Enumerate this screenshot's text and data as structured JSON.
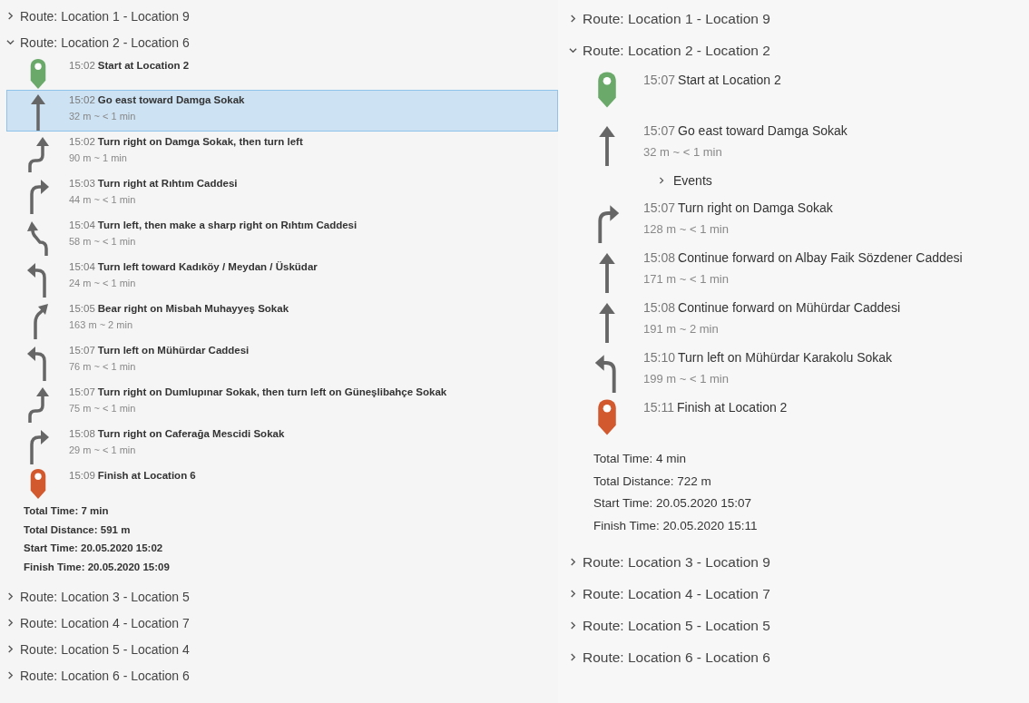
{
  "panels": [
    {
      "routes": [
        {
          "title": "Route: Location 1 - Location 9",
          "expanded": false
        },
        {
          "title": "Route: Location 2 - Location 6",
          "expanded": true,
          "steps": [
            {
              "kind": "start",
              "time": "15:02",
              "text": "Start at Location 2",
              "selected": false
            },
            {
              "kind": "straight",
              "time": "15:02",
              "text": "Go east toward Damga Sokak",
              "detail": "32 m ~ < 1 min",
              "selected": true
            },
            {
              "kind": "right_then_left",
              "time": "15:02",
              "text": "Turn right on Damga Sokak, then turn left",
              "detail": "90 m ~ 1 min",
              "selected": false
            },
            {
              "kind": "right",
              "time": "15:03",
              "text": "Turn right at Rıhtım Caddesi",
              "detail": "44 m ~ < 1 min",
              "selected": false
            },
            {
              "kind": "left_then_sharp_right",
              "time": "15:04",
              "text": "Turn left, then make a sharp right on Rıhtım Caddesi",
              "detail": "58 m ~ < 1 min",
              "selected": false
            },
            {
              "kind": "left",
              "time": "15:04",
              "text": "Turn left toward Kadıköy / Meydan / Üsküdar",
              "detail": "24 m ~ < 1 min",
              "selected": false
            },
            {
              "kind": "bear_right",
              "time": "15:05",
              "text": "Bear right on Misbah Muhayyeş Sokak",
              "detail": "163 m ~ 2 min",
              "selected": false
            },
            {
              "kind": "left",
              "time": "15:07",
              "text": "Turn left on Mühürdar Caddesi",
              "detail": "76 m ~ < 1 min",
              "selected": false
            },
            {
              "kind": "right_then_left",
              "time": "15:07",
              "text": "Turn right on Dumlupınar Sokak, then turn left on Güneşlibahçe Sokak",
              "detail": "75 m ~ < 1 min",
              "selected": false
            },
            {
              "kind": "right",
              "time": "15:08",
              "text": "Turn right on Caferağa Mescidi Sokak",
              "detail": "29 m ~ < 1 min",
              "selected": false
            },
            {
              "kind": "finish",
              "time": "15:09",
              "text": "Finish at Location 6",
              "selected": false
            }
          ],
          "summary": [
            "Total Time: 7 min",
            "Total Distance: 591 m",
            "Start Time: 20.05.2020 15:02",
            "Finish Time: 20.05.2020 15:09"
          ]
        },
        {
          "title": "Route: Location 3 - Location 5",
          "expanded": false
        },
        {
          "title": "Route: Location 4 - Location 7",
          "expanded": false
        },
        {
          "title": "Route: Location 5 - Location 4",
          "expanded": false
        },
        {
          "title": "Route: Location 6 - Location 6",
          "expanded": false
        }
      ]
    },
    {
      "routes": [
        {
          "title": "Route: Location 1 - Location 9",
          "expanded": false
        },
        {
          "title": "Route: Location 2 - Location 2",
          "expanded": true,
          "steps": [
            {
              "kind": "start",
              "time": "15:07",
              "text": "Start at Location 2",
              "selected": false
            },
            {
              "kind": "straight",
              "time": "15:07",
              "text": "Go east toward Damga Sokak",
              "detail": "32 m ~ < 1 min",
              "selected": false,
              "events": {
                "label": "Events",
                "expanded": false
              }
            },
            {
              "kind": "right",
              "time": "15:07",
              "text": "Turn right on Damga Sokak",
              "detail": "128 m ~ < 1 min",
              "selected": false
            },
            {
              "kind": "straight",
              "time": "15:08",
              "text": "Continue forward on Albay Faik Sözdener Caddesi",
              "detail": "171 m ~ < 1 min",
              "selected": false
            },
            {
              "kind": "straight",
              "time": "15:08",
              "text": "Continue forward on Mühürdar Caddesi",
              "detail": "191 m ~ 2 min",
              "selected": false
            },
            {
              "kind": "left",
              "time": "15:10",
              "text": "Turn left on Mühürdar Karakolu Sokak",
              "detail": "199 m ~ < 1 min",
              "selected": false
            },
            {
              "kind": "finish",
              "time": "15:11",
              "text": "Finish at Location 2",
              "selected": false
            }
          ],
          "summary": [
            "Total Time: 4 min",
            "Total Distance: 722 m",
            "Start Time: 20.05.2020 15:07",
            "Finish Time: 20.05.2020 15:11"
          ]
        },
        {
          "title": "Route: Location 3 - Location 9",
          "expanded": false
        },
        {
          "title": "Route: Location 4 - Location 7",
          "expanded": false
        },
        {
          "title": "Route: Location 5 - Location 5",
          "expanded": false
        },
        {
          "title": "Route: Location 6 - Location 6",
          "expanded": false
        }
      ]
    }
  ]
}
